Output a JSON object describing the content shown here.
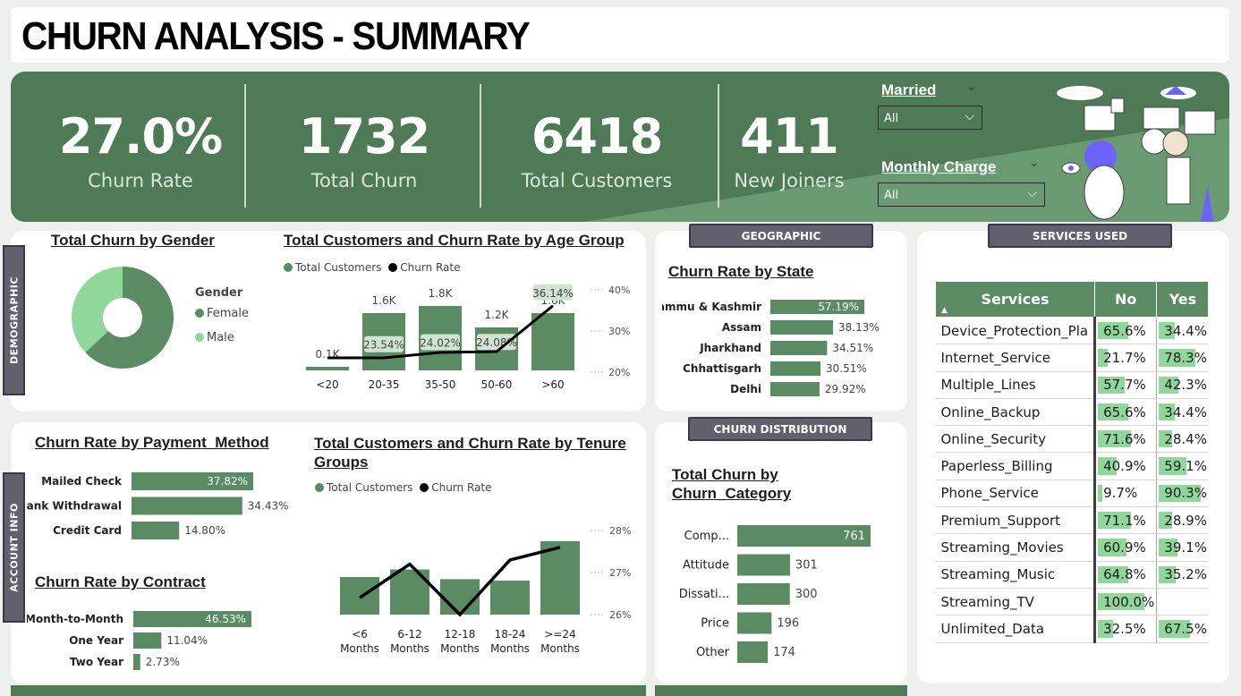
{
  "title": "CHURN ANALYSIS - SUMMARY",
  "kpis": [
    {
      "value": "27.0%",
      "label": "Churn Rate"
    },
    {
      "value": "1732",
      "label": "Total Churn"
    },
    {
      "value": "6418",
      "label": "Total Customers"
    },
    {
      "value": "411",
      "label": "New Joiners"
    }
  ],
  "slicers": {
    "married": {
      "title": "Married",
      "value": "All"
    },
    "monthly_charge": {
      "title": "Monthly Charge",
      "value": "All"
    }
  },
  "tabs": {
    "demographic": "DEMOGRAPHIC",
    "account_info": "ACCOUNT INFO",
    "geographic": "GEOGRAPHIC",
    "services_used": "SERVICES USED",
    "churn_distribution": "CHURN DISTRIBUTION"
  },
  "colors": {
    "primary": "#5a8b63",
    "light": "#8fd79a",
    "band": "#4e7a55",
    "pill": "#61606e"
  },
  "charts": {
    "gender": {
      "title": "Total Churn by Gender",
      "legend_title": "Gender"
    },
    "age": {
      "title": "Total Customers and Churn Rate by Age Group",
      "legend": [
        "Total Customers",
        "Churn Rate"
      ]
    },
    "state": {
      "title": "Churn Rate by State"
    },
    "payment": {
      "title": "Churn Rate by Payment_Method"
    },
    "contract": {
      "title": "Churn Rate by Contract"
    },
    "tenure": {
      "title": "Total Customers and Churn Rate by Tenure Groups",
      "legend": [
        "Total Customers",
        "Churn Rate"
      ]
    },
    "category": {
      "title": "Total Churn by Churn_Category"
    }
  },
  "chart_data": [
    {
      "type": "pie",
      "title": "Total Churn by Gender",
      "categories": [
        "Female",
        "Male"
      ],
      "values": [
        63,
        37
      ]
    },
    {
      "type": "bar",
      "title": "Total Customers and Churn Rate by Age Group",
      "categories": [
        "<20",
        "20-35",
        "35-50",
        "50-60",
        ">60"
      ],
      "series": [
        {
          "name": "Total Customers",
          "values": [
            0.1,
            1.6,
            1.8,
            1.2,
            1.6
          ],
          "labels": [
            "0.1K",
            "1.6K",
            "1.8K",
            "1.2K",
            "1.6K"
          ]
        },
        {
          "name": "Churn Rate",
          "values": [
            22.0,
            23.54,
            24.02,
            24.08,
            36.14
          ],
          "labels": [
            "",
            "23.54%",
            "24.02%",
            "24.08%",
            "36.14%"
          ]
        }
      ],
      "y2_ticks": [
        "40%",
        "30%",
        "20%"
      ]
    },
    {
      "type": "bar",
      "title": "Churn Rate by State",
      "categories": [
        "Jammu & Kashmir",
        "Assam",
        "Jharkhand",
        "Chhattisgarh",
        "Delhi"
      ],
      "values": [
        57.19,
        38.13,
        34.51,
        30.51,
        29.92
      ],
      "labels": [
        "57.19%",
        "38.13%",
        "34.51%",
        "30.51%",
        "29.92%"
      ]
    },
    {
      "type": "bar",
      "title": "Churn Rate by Payment_Method",
      "categories": [
        "Mailed Check",
        "Bank Withdrawal",
        "Credit Card"
      ],
      "values": [
        37.82,
        34.43,
        14.8
      ],
      "labels": [
        "37.82%",
        "34.43%",
        "14.80%"
      ]
    },
    {
      "type": "bar",
      "title": "Churn Rate by Contract",
      "categories": [
        "Month-to-Month",
        "One Year",
        "Two Year"
      ],
      "values": [
        46.53,
        11.04,
        2.73
      ],
      "labels": [
        "46.53%",
        "11.04%",
        "2.73%"
      ]
    },
    {
      "type": "bar",
      "title": "Total Customers and Churn Rate by Tenure Groups",
      "categories": [
        "<6 Months",
        "6-12 Months",
        "12-18 Months",
        "18-24 Months",
        ">=24 Months"
      ],
      "category_lines": [
        [
          "<6",
          "Months"
        ],
        [
          "6-12",
          "Months"
        ],
        [
          "12-18",
          "Months"
        ],
        [
          "18-24",
          "Months"
        ],
        [
          ">=24",
          "Months"
        ]
      ],
      "series": [
        {
          "name": "Total Customers",
          "values": [
            1050,
            1260,
            990,
            950,
            2050
          ]
        },
        {
          "name": "Churn Rate",
          "values": [
            26.4,
            27.2,
            26.0,
            27.3,
            27.6
          ]
        }
      ],
      "y2_ticks": [
        "28%",
        "27%",
        "26%"
      ]
    },
    {
      "type": "bar",
      "title": "Total Churn by Churn_Category",
      "categories": [
        "Comp...",
        "Attitude",
        "Dissati...",
        "Price",
        "Other"
      ],
      "values": [
        761,
        301,
        300,
        196,
        174
      ],
      "labels": [
        "761",
        "301",
        "300",
        "196",
        "174"
      ]
    },
    {
      "type": "table",
      "title": "SERVICES USED",
      "columns": [
        "Services",
        "No",
        "Yes"
      ],
      "rows": [
        {
          "service": "Device_Protection_Pla",
          "no": 65.6,
          "yes": 34.4,
          "no_label": "65.6%",
          "yes_label": "34.4%"
        },
        {
          "service": "Internet_Service",
          "no": 21.7,
          "yes": 78.3,
          "no_label": "21.7%",
          "yes_label": "78.3%"
        },
        {
          "service": "Multiple_Lines",
          "no": 57.7,
          "yes": 42.3,
          "no_label": "57.7%",
          "yes_label": "42.3%"
        },
        {
          "service": "Online_Backup",
          "no": 65.6,
          "yes": 34.4,
          "no_label": "65.6%",
          "yes_label": "34.4%"
        },
        {
          "service": "Online_Security",
          "no": 71.6,
          "yes": 28.4,
          "no_label": "71.6%",
          "yes_label": "28.4%"
        },
        {
          "service": "Paperless_Billing",
          "no": 40.9,
          "yes": 59.1,
          "no_label": "40.9%",
          "yes_label": "59.1%"
        },
        {
          "service": "Phone_Service",
          "no": 9.7,
          "yes": 90.3,
          "no_label": "9.7%",
          "yes_label": "90.3%"
        },
        {
          "service": "Premium_Support",
          "no": 71.1,
          "yes": 28.9,
          "no_label": "71.1%",
          "yes_label": "28.9%"
        },
        {
          "service": "Streaming_Movies",
          "no": 60.9,
          "yes": 39.1,
          "no_label": "60.9%",
          "yes_label": "39.1%"
        },
        {
          "service": "Streaming_Music",
          "no": 64.8,
          "yes": 35.2,
          "no_label": "64.8%",
          "yes_label": "35.2%"
        },
        {
          "service": "Streaming_TV",
          "no": 100.0,
          "yes": null,
          "no_label": "100.0%",
          "yes_label": ""
        },
        {
          "service": "Unlimited_Data",
          "no": 32.5,
          "yes": 67.5,
          "no_label": "32.5%",
          "yes_label": "67.5%"
        }
      ]
    }
  ]
}
